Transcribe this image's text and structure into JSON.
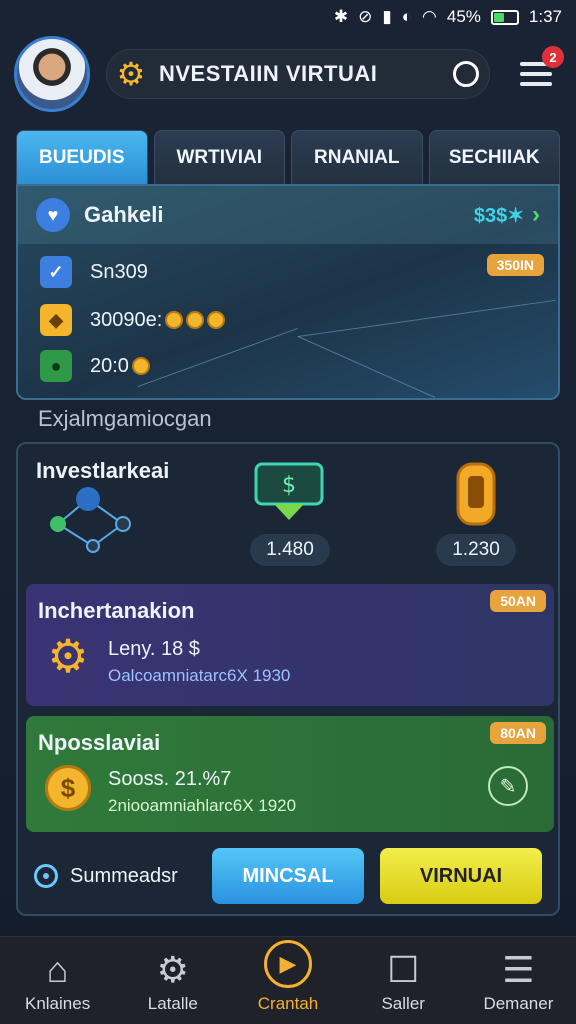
{
  "status_bar": {
    "battery_text": "45%",
    "time": "1:37",
    "battery_fill": 0.45
  },
  "header": {
    "title": "NVESTAIIN VIRTUAI",
    "notification_count": "2"
  },
  "tabs": [
    {
      "label": "BUEUDIS",
      "active": true
    },
    {
      "label": "WRTIVIAI",
      "active": false
    },
    {
      "label": "RNANIAL",
      "active": false
    },
    {
      "label": "SECHIIAK",
      "active": false
    }
  ],
  "summary": {
    "title": "Gahkeli",
    "amount": "$3$✶",
    "badge": "350IN",
    "rows": [
      {
        "icon": "check-icon",
        "text": "Sn309"
      },
      {
        "icon": "wallet-icon",
        "text": "30090e: ",
        "coins": "0 0 0"
      },
      {
        "icon": "cash-icon",
        "text": "20:0",
        "coins": "0"
      }
    ]
  },
  "section_label": "Exjalmgamiocgan",
  "invest": {
    "title": "Investlarkeai",
    "value1": "1.480",
    "value2": "1.230"
  },
  "card_purple": {
    "title": "Inchertanakion",
    "badge": "50AN",
    "line1": "Leny. 18 $",
    "line2": "Oalcoamniatarc6X 1930"
  },
  "card_green": {
    "title": "Nposslaviai",
    "badge": "80AN",
    "line1": "Sooss. 21.%7",
    "line2": "2niooamniahlarc6X 1920"
  },
  "bottom": {
    "label": "Summeadsr",
    "btn_blue": "MINCSAL",
    "btn_yellow": "VIRNUAI"
  },
  "nav": [
    {
      "label": "Knlaines",
      "icon": "home-icon",
      "active": false
    },
    {
      "label": "Latalle",
      "icon": "gear-icon",
      "active": false
    },
    {
      "label": "Crantah",
      "icon": "play-icon",
      "active": true
    },
    {
      "label": "Saller",
      "icon": "chat-icon",
      "active": false
    },
    {
      "label": "Demaner",
      "icon": "list-icon",
      "active": false
    }
  ],
  "colors": {
    "accent_blue": "#2b8fd4",
    "accent_yellow": "#d8cc13",
    "badge_orange": "#e7a33c",
    "green_card": "#2f7a3a",
    "purple_card": "#3a3472"
  }
}
